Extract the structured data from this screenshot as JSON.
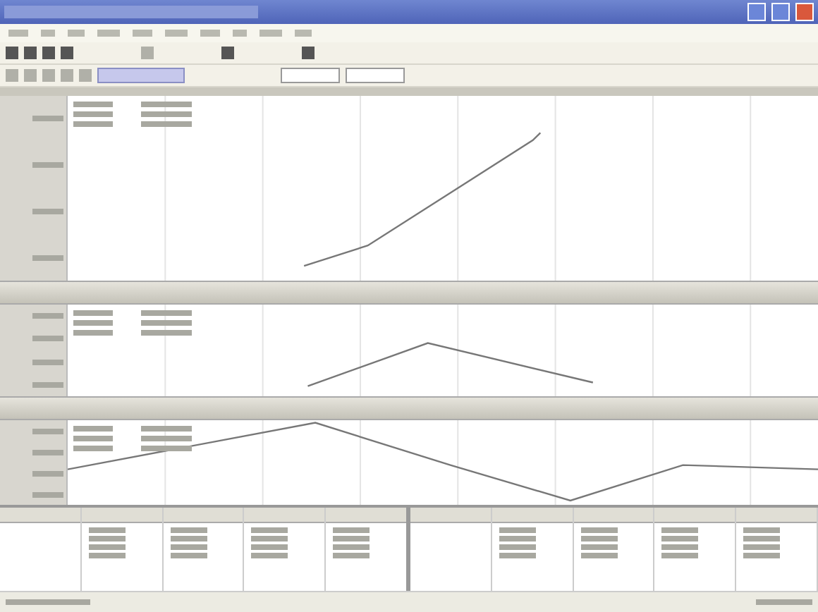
{
  "window": {
    "kind": "app-window"
  },
  "panes": [
    {
      "kind": "rising"
    },
    {
      "kind": "peak"
    },
    {
      "kind": "zigzag"
    }
  ],
  "table": {
    "kind": "grid"
  }
}
